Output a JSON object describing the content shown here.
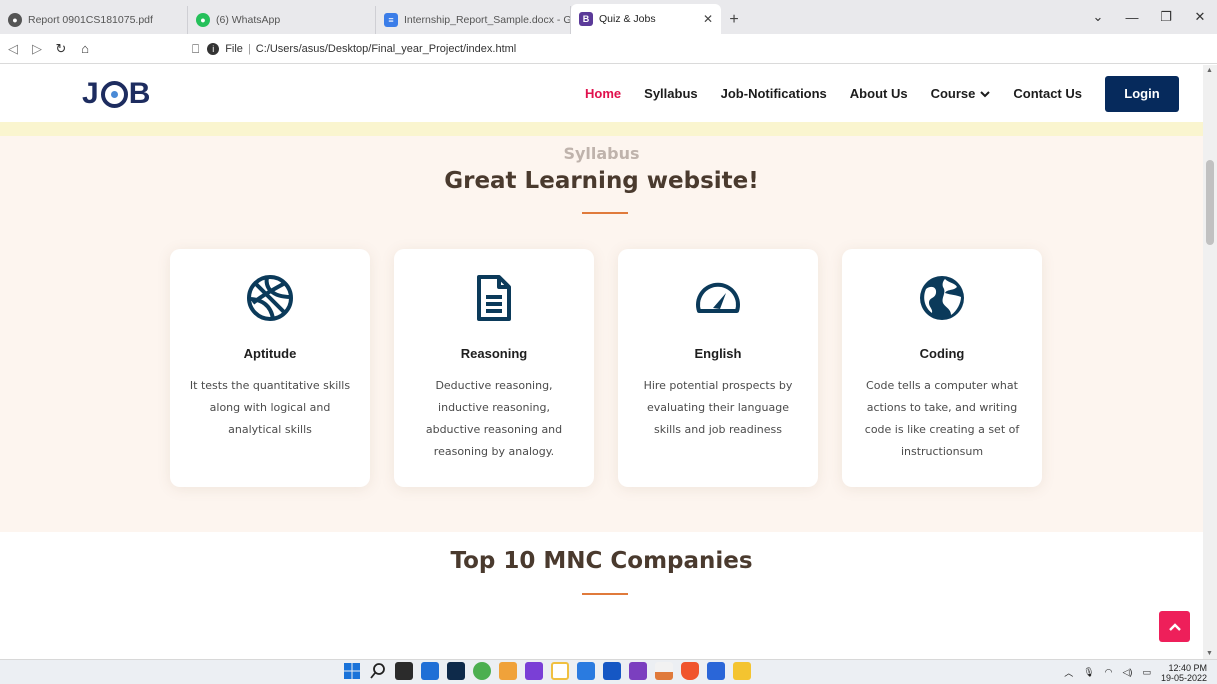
{
  "browser": {
    "tabs": [
      {
        "label": "Report 0901CS181075.pdf",
        "icon": "globe-icon",
        "active": false
      },
      {
        "label": "(6) WhatsApp",
        "icon": "whatsapp-icon",
        "active": false
      },
      {
        "label": "Internship_Report_Sample.docx - Goo",
        "icon": "docs-icon",
        "active": false
      },
      {
        "label": "Quiz & Jobs",
        "icon": "bootstrap-icon",
        "active": true,
        "icon_text": "B"
      }
    ],
    "address": {
      "scheme_label": "File",
      "path": "C:/Users/asus/Desktop/Final_year_Project/index.html"
    }
  },
  "site": {
    "nav": {
      "items": [
        "Home",
        "Syllabus",
        "Job-Notifications",
        "About Us",
        "Course",
        "Contact Us"
      ],
      "active": "Home",
      "login_label": "Login"
    },
    "syllabus": {
      "subtitle": "Syllabus",
      "title": "Great Learning website!",
      "cards": [
        {
          "title": "Aptitude",
          "icon": "basketball-icon",
          "description": "It tests the quantitative skills along with logical and analytical skills"
        },
        {
          "title": "Reasoning",
          "icon": "document-icon",
          "description": "Deductive reasoning, inductive reasoning, abductive reasoning and reasoning by analogy."
        },
        {
          "title": "English",
          "icon": "speedometer-icon",
          "description": "Hire potential prospects by evaluating their language skills and job readiness"
        },
        {
          "title": "Coding",
          "icon": "globe-icon",
          "description": "Code tells a computer what actions to take, and writing code is like creating a set of instructionsum"
        }
      ]
    },
    "companies": {
      "title": "Top 10 MNC Companies"
    }
  },
  "taskbar": {
    "time": "12:40 PM",
    "date": "19-05-2022"
  },
  "colors": {
    "accent": "#e0114d",
    "navy": "#062a5c",
    "icon": "#0b3a5a",
    "section_bg": "#fdf5ef",
    "divider": "#e07a3b"
  }
}
